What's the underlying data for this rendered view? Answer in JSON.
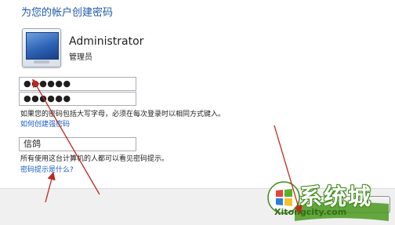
{
  "page": {
    "title": "为您的帐户创建密码"
  },
  "account": {
    "name": "Administrator",
    "role": "管理员"
  },
  "form": {
    "password_value": "●●●●●●",
    "confirm_value": "●●●●●●",
    "case_note": "如果您的密码包括大写字母，必须在每次登录时以相同方式键入。",
    "strong_password_link": "如何创建强密码",
    "hint_value": "信鸽",
    "hint_note": "所有使用这台计算机的人都可以看见密码提示。",
    "hint_help_link": "密码提示是什么?"
  },
  "watermark": {
    "brand": "系统城",
    "domain": "Xitongcity.com"
  },
  "colors": {
    "title": "#1e5aa8",
    "link": "#1a5cc8",
    "arrow": "#c0281e",
    "watermark_green": "#3f8c1a"
  }
}
